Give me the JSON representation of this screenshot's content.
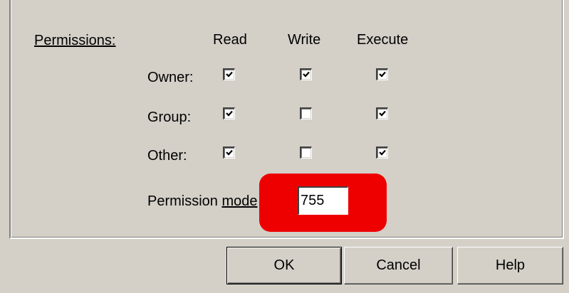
{
  "permissions": {
    "label": "Permissions:",
    "columns": {
      "read": "Read",
      "write": "Write",
      "execute": "Execute"
    },
    "rows": [
      {
        "label": "Owner:",
        "read": true,
        "write": true,
        "execute": true
      },
      {
        "label": "Group:",
        "read": true,
        "write": false,
        "execute": true
      },
      {
        "label": "Other:",
        "read": true,
        "write": false,
        "execute": true
      }
    ]
  },
  "mode": {
    "label_pre": "Permission ",
    "label_ul": "mode",
    "value": "755",
    "highlight_color": "#ee0000"
  },
  "buttons": {
    "ok": "OK",
    "cancel": "Cancel",
    "help": "Help"
  }
}
